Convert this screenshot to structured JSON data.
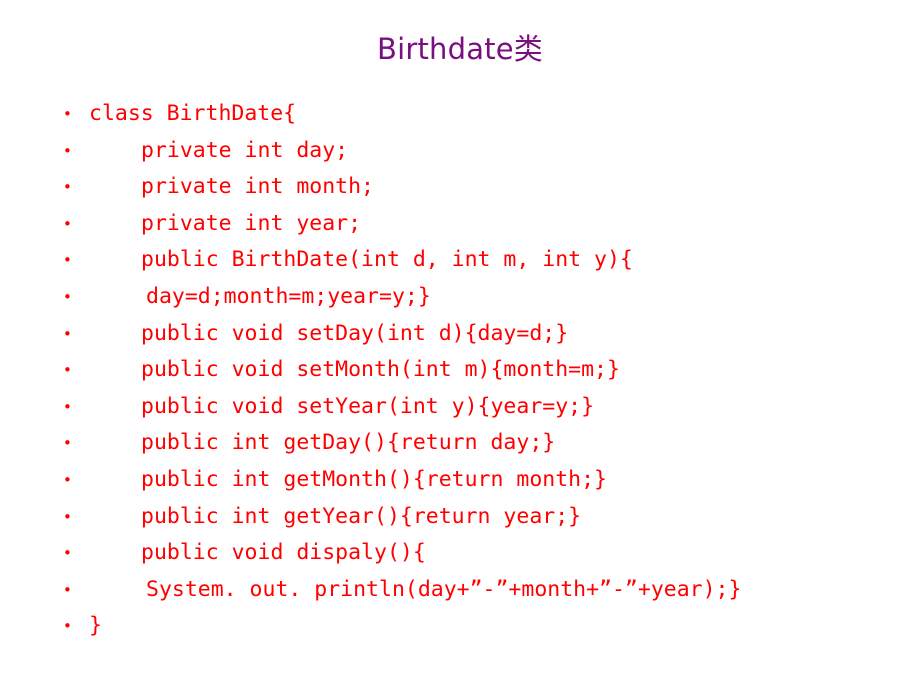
{
  "slide": {
    "title": "Birthdate类",
    "title_color": "#7B0F82",
    "code_color": "#FF0000",
    "background_color": "#FFFFFF",
    "bullet_glyph": "•",
    "lines": [
      {
        "level": 1,
        "text": "class BirthDate{"
      },
      {
        "level": 2,
        "text": "private int day;"
      },
      {
        "level": 2,
        "text": "private int month;"
      },
      {
        "level": 2,
        "text": "private int year;"
      },
      {
        "level": 2,
        "text": "public BirthDate(int d, int m, int y){"
      },
      {
        "level": 3,
        "text": "day=d;month=m;year=y;}"
      },
      {
        "level": 2,
        "text": "public void setDay(int d){day=d;}"
      },
      {
        "level": 2,
        "text": "public void setMonth(int m){month=m;}"
      },
      {
        "level": 2,
        "text": "public void setYear(int y){year=y;}"
      },
      {
        "level": 2,
        "text": "public int getDay(){return day;}"
      },
      {
        "level": 2,
        "text": "public int getMonth(){return month;}"
      },
      {
        "level": 2,
        "text": "public int getYear(){return year;}"
      },
      {
        "level": 2,
        "text": "public void dispaly(){"
      },
      {
        "level": 3,
        "text": "System. out. println(day+”-”+month+”-”+year);}"
      },
      {
        "level": 1,
        "text": "}"
      }
    ]
  }
}
